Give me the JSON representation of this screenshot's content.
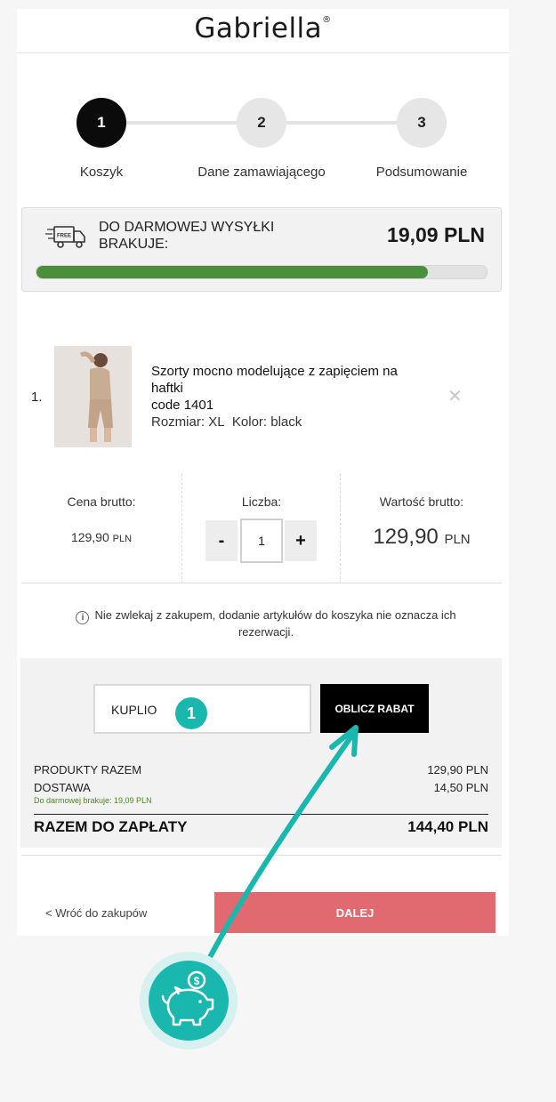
{
  "header": {
    "logo": "Gabriella",
    "logo_mark": "®"
  },
  "steps": [
    {
      "number": "1",
      "label": "Koszyk",
      "active": true
    },
    {
      "number": "2",
      "label": "Dane zamawiającego",
      "active": false
    },
    {
      "number": "3",
      "label": "Podsumowanie",
      "active": false
    }
  ],
  "shipping": {
    "icon_label": "FREE",
    "message": "DO DARMOWEJ WYSYŁKI BRAKUJE:",
    "amount": "19,09 PLN",
    "progress_percent": 87
  },
  "product": {
    "index": "1.",
    "name": "Szorty mocno modelujące z zapięciem na haftki",
    "code": "code 1401",
    "size_label": "Rozmiar:",
    "size_value": "XL",
    "color_label": "Kolor:",
    "color_value": "black"
  },
  "price": {
    "unit_label": "Cena brutto:",
    "unit_value": "129,90",
    "currency": "PLN",
    "qty_label": "Liczba:",
    "qty_value": "1",
    "qty_minus": "-",
    "qty_plus": "+",
    "total_label": "Wartość brutto:",
    "total_value": "129,90"
  },
  "notice": {
    "icon": "i",
    "text": "Nie zwlekaj z zakupem, dodanie artykułów do koszyka nie oznacza ich rezerwacji."
  },
  "summary": {
    "coupon_value": "KUPLIO",
    "coupon_badge": "1",
    "calc_button": "OBLICZ RABAT",
    "products_label": "PRODUKTY RAZEM",
    "products_value": "129,90 PLN",
    "delivery_label": "DOSTAWA",
    "delivery_value": "14,50 PLN",
    "free_note": "Do darmowej brakuje: 19,09 PLN",
    "total_label": "RAZEM DO ZAPŁATY",
    "total_value": "144,40 PLN"
  },
  "footer": {
    "back_link": "< Wróć do zakupów",
    "next_button": "DALEJ"
  },
  "colors": {
    "accent_teal": "#19b7ad",
    "progress_green": "#4b8f3c",
    "next_button": "#e06a70",
    "free_note_green": "#4a8a1a"
  }
}
